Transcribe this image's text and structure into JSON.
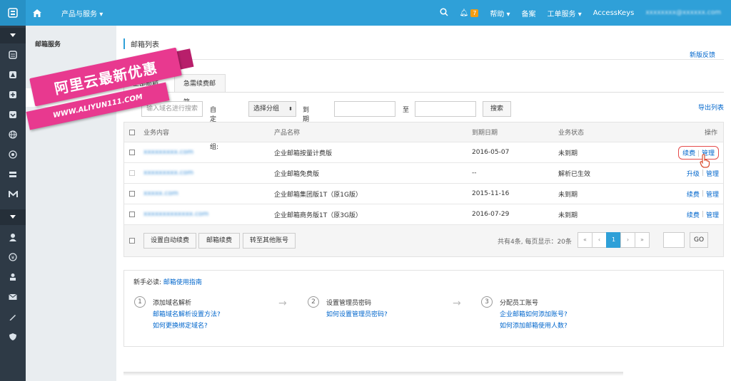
{
  "topbar": {
    "products_label": "产品与服务",
    "notif_count": "7",
    "help_label": "帮助",
    "beian_label": "备案",
    "ticket_label": "工单服务",
    "accesskeys_label": "AccessKeys",
    "user_email": "xxxxxxxx@xxxxxx.com"
  },
  "subnav": {
    "title": "邮箱服务",
    "item": "邮箱列表"
  },
  "page": {
    "title": "邮箱列表",
    "feedback": "新版反馈",
    "export": "导出列表"
  },
  "tabs": [
    "全部邮箱",
    "急需续费邮箱"
  ],
  "filters": {
    "search_placeholder": "输入域名进行搜索",
    "group_label": "自定义分组:",
    "group_select": "选择分组",
    "date_label": "到期日期:",
    "to_label": "至",
    "search_button": "搜索"
  },
  "table": {
    "headers": [
      "业务内容",
      "产品名称",
      "到期日期",
      "业务状态",
      "操作"
    ],
    "rows": [
      {
        "domain": "xxxxxxxxx.com",
        "product": "企业邮箱按量计费版",
        "date": "2016-05-07",
        "status": "未到期",
        "op1": "续费",
        "op2": "管理"
      },
      {
        "domain": "xxxxxxxxx.com",
        "product": "企业邮箱免费版",
        "date": "--",
        "status": "解析已生效",
        "op1": "升级",
        "op2": "管理"
      },
      {
        "domain": "xxxxx.com",
        "product": "企业邮箱集团版1T（原1G版）",
        "date": "2015-11-16",
        "status": "未到期",
        "op1": "续费",
        "op2": "管理"
      },
      {
        "domain": "xxxxxxxxxxxxx.com",
        "product": "企业邮箱商务版1T（原3G版）",
        "date": "2016-07-29",
        "status": "未到期",
        "op1": "续费",
        "op2": "管理"
      }
    ],
    "footer_buttons": [
      "设置自动续费",
      "邮箱续费",
      "转至其他账号"
    ],
    "summary": "共有4条, 每页显示：20条",
    "pager": [
      "«",
      "‹",
      "1",
      "›",
      "»"
    ],
    "go": "GO"
  },
  "guide": {
    "title": "新手必读:",
    "title_link": "邮箱使用指南",
    "steps": [
      {
        "num": "1",
        "title": "添加域名解析",
        "links": [
          "邮箱域名解析设置方法?",
          "如何更换绑定域名?"
        ]
      },
      {
        "num": "2",
        "title": "设置管理员密码",
        "links": [
          "如何设置管理员密码?"
        ]
      },
      {
        "num": "3",
        "title": "分配员工账号",
        "links": [
          "企业邮箱如何添加账号?",
          "如何添加邮箱使用人数?"
        ]
      }
    ]
  },
  "watermark": {
    "line1": "阿里云最新优惠",
    "line2": "WWW.ALIYUN111.COM"
  }
}
